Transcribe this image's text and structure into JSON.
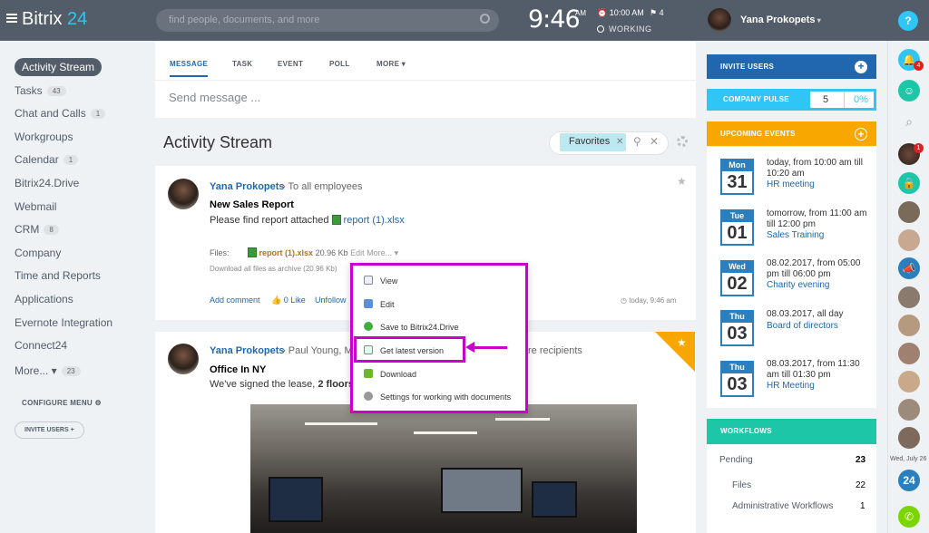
{
  "app": {
    "logo_a": "Bitrix",
    "logo_b": " 24"
  },
  "search": {
    "placeholder": "find people, documents, and more"
  },
  "clock": {
    "time": "9:46",
    "ampm": "AM",
    "alarm": "10:00 AM",
    "flags": "4",
    "status": "WORKING"
  },
  "user": {
    "name": "Yana Prokopets"
  },
  "sidebar": {
    "items": [
      {
        "label": "Activity Stream",
        "count": ""
      },
      {
        "label": "Tasks",
        "count": "43"
      },
      {
        "label": "Chat and Calls",
        "count": "1"
      },
      {
        "label": "Workgroups",
        "count": ""
      },
      {
        "label": "Calendar",
        "count": "1"
      },
      {
        "label": "Bitrix24.Drive",
        "count": ""
      },
      {
        "label": "Webmail",
        "count": ""
      },
      {
        "label": "CRM",
        "count": "8"
      },
      {
        "label": "Company",
        "count": ""
      },
      {
        "label": "Time and Reports",
        "count": ""
      },
      {
        "label": "Applications",
        "count": ""
      },
      {
        "label": "Evernote Integration",
        "count": ""
      },
      {
        "label": "Connect24",
        "count": ""
      },
      {
        "label": "More... ▾",
        "count": "23"
      }
    ],
    "configure": "CONFIGURE MENU",
    "invite": "INVITE USERS +"
  },
  "composer": {
    "tabs": [
      "MESSAGE",
      "TASK",
      "EVENT",
      "POLL",
      "MORE ▾"
    ],
    "placeholder": "Send message ..."
  },
  "stream": {
    "title": "Activity Stream",
    "filter": "Favorites"
  },
  "post1": {
    "author": "Yana Prokopets",
    "to": "To all employees",
    "title": "New Sales Report",
    "text": "Please find report attached",
    "attachment": "report (1).xlsx",
    "files_label": "Files:",
    "file_name": "report (1).xlsx",
    "file_size": "20.96 Kb",
    "edit": "Edit",
    "more": "More... ▾",
    "archive": "Download all files as archive (20.96 Kb)",
    "add_comment": "Add comment",
    "likes": "0 Like",
    "unfollow": "Unfollow",
    "time": "today, 9:46 am"
  },
  "post2": {
    "author": "Yana Prokopets",
    "to": "Paul Young, M",
    "recipients": "re recipients",
    "title": "Office In NY",
    "text": "We've signed the lease, ",
    "text_bold": "2 floors, 4"
  },
  "context_menu": {
    "items": [
      "View",
      "Edit",
      "Save to Bitrix24.Drive",
      "Get latest version",
      "Download",
      "Settings for working with documents"
    ]
  },
  "right": {
    "invite": "INVITE USERS",
    "pulse": "COMPANY PULSE",
    "pulse_val": "5",
    "pulse_pct": "0%",
    "events_head": "UPCOMING EVENTS",
    "events": [
      {
        "dow": "Mon",
        "day": "31",
        "line1": "today, from 10:00 am till",
        "line2": "10:20 am",
        "link": "HR meeting"
      },
      {
        "dow": "Tue",
        "day": "01",
        "line1": "tomorrow, from 11:00 am",
        "line2": "till 12:00 pm",
        "link": "Sales Training"
      },
      {
        "dow": "Wed",
        "day": "02",
        "line1": "08.02.2017, from 05:00",
        "line2": "pm till 06:00 pm",
        "link": "Charity evening"
      },
      {
        "dow": "Thu",
        "day": "03",
        "line1": "08.03.2017, all day",
        "line2": "",
        "link": "Board of directors"
      },
      {
        "dow": "Thu",
        "day": "03",
        "line1": "08.03.2017, from 11:30",
        "line2": "am till 01:30 pm",
        "link": "HR Meeting"
      }
    ],
    "wf_head": "WORKFLOWS",
    "wf": [
      {
        "label": "Pending",
        "val": "23"
      },
      {
        "label": "Files",
        "val": "22"
      },
      {
        "label": "Administrative Workflows",
        "val": "1"
      }
    ]
  },
  "rightbar": {
    "help": "?",
    "notif": "4",
    "chat_badge": "1",
    "date": "Wed, July 26",
    "b24": "24"
  }
}
